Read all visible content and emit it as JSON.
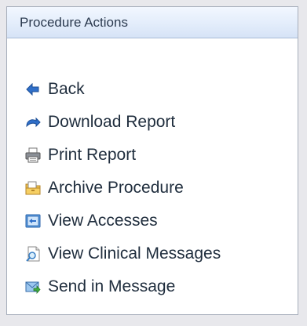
{
  "panel": {
    "title": "Procedure Actions",
    "actions": [
      {
        "label": "Back",
        "icon": "back-arrow-icon"
      },
      {
        "label": "Download Report",
        "icon": "download-icon"
      },
      {
        "label": "Print Report",
        "icon": "printer-icon"
      },
      {
        "label": "Archive Procedure",
        "icon": "archive-folder-icon"
      },
      {
        "label": "View Accesses",
        "icon": "accesses-icon"
      },
      {
        "label": "View Clinical Messages",
        "icon": "clinical-messages-icon"
      },
      {
        "label": "Send in Message",
        "icon": "send-message-icon"
      }
    ]
  },
  "colors": {
    "background": "#e8e8ec",
    "panel_border": "#a6aebb",
    "header_gradient_top": "#f2f7ff",
    "header_gradient_bottom": "#d6e3f6",
    "text": "#1f2d3d",
    "icon_blue": "#2f6fc9"
  }
}
